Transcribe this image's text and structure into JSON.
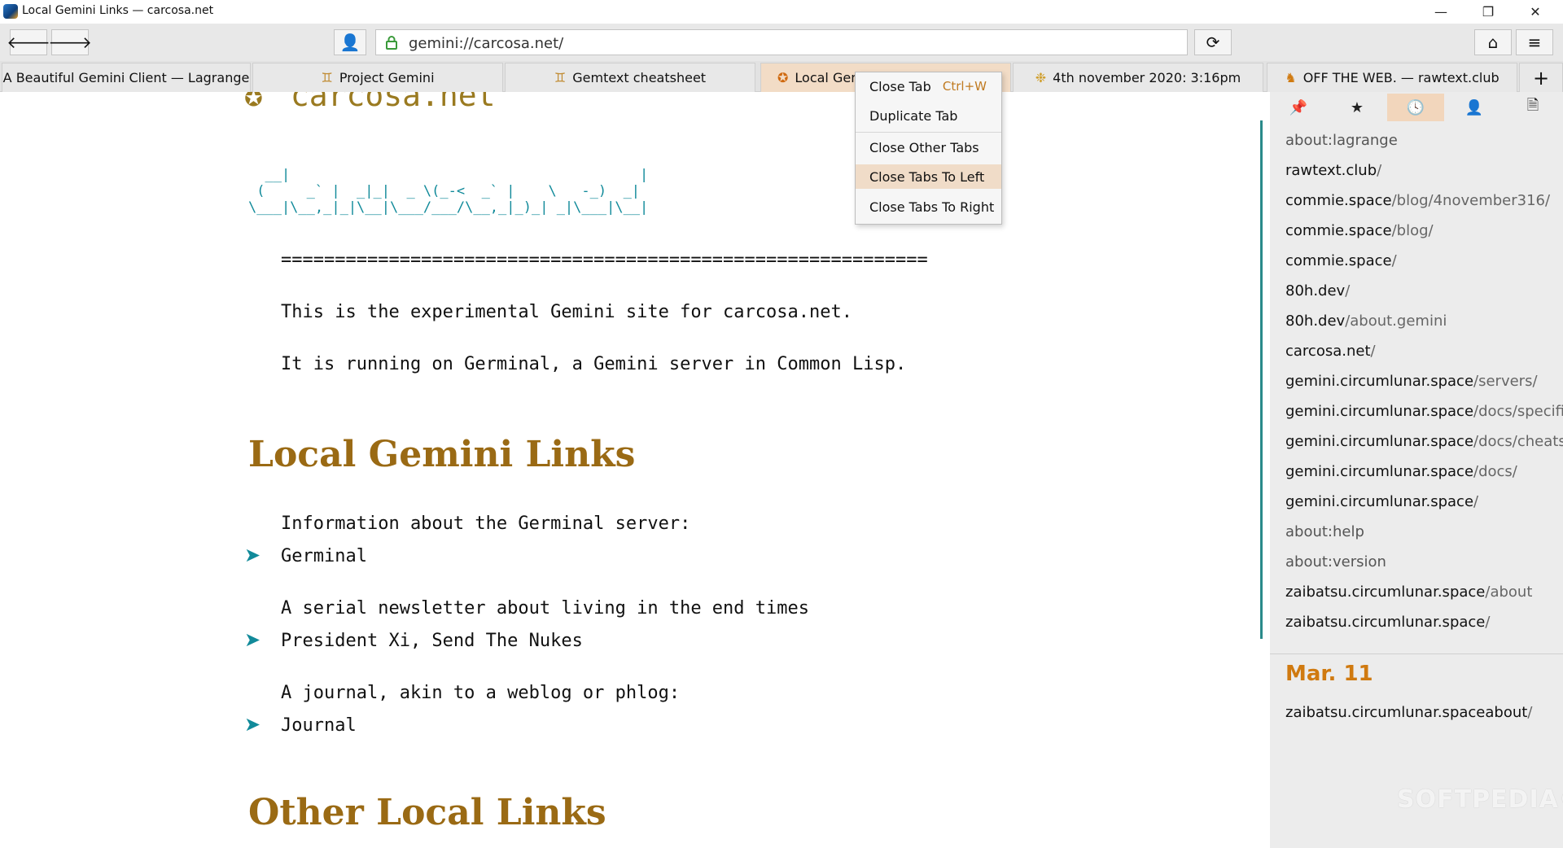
{
  "window": {
    "title": "Local Gemini Links — carcosa.net",
    "min_glyph": "—",
    "max_glyph": "❐",
    "close_glyph": "✕"
  },
  "nav": {
    "back_glyph": "🡐",
    "forward_glyph": "🡒",
    "identity_glyph": "👤",
    "url": "gemini://carcosa.net/",
    "reload_glyph": "⟳",
    "home_glyph": "⌂",
    "menu_glyph": "≡"
  },
  "tabs": [
    {
      "label": "A Beautiful Gemini Client — Lagrange",
      "icon": ""
    },
    {
      "label": "Project Gemini",
      "icon": "♊"
    },
    {
      "label": "Gemtext cheatsheet",
      "icon": "♊"
    },
    {
      "label": "Local Gemini Links",
      "icon": "✪"
    },
    {
      "label": "4th november 2020: 3:16pm",
      "icon": "❉"
    },
    {
      "label": "OFF THE WEB. — rawtext.club",
      "icon": "♞"
    }
  ],
  "new_tab_glyph": "+",
  "context_menu": {
    "items": [
      {
        "label": "Close Tab",
        "shortcut": "Ctrl+W"
      },
      {
        "label": "Duplicate Tab",
        "shortcut": ""
      },
      {
        "label": "Close Other Tabs",
        "shortcut": ""
      },
      {
        "label": "Close Tabs To Left",
        "shortcut": ""
      },
      {
        "label": "Close Tabs To Right",
        "shortcut": ""
      }
    ]
  },
  "page": {
    "banner_icon": "✪",
    "banner": "carcosa.net",
    "ascii_art": "  __|                                          |\n (     _` |  _|_|  _ \\(_-<  _` |    \\   -_)  _|\n\\___|\\__,_|_|\\__|\\___/___/\\__,_|_)_| _|\\___|\\__|",
    "rule": "============================================================",
    "intro_1": "This is the experimental Gemini site for carcosa.net.",
    "intro_2": "It is running on Germinal, a Gemini server in Common Lisp.",
    "heading_1": "Local Gemini Links",
    "desc_1": "Information about the Germinal server:",
    "link_1": "Germinal",
    "desc_2": "A serial newsletter about living in the end times",
    "link_2": "President Xi, Send The Nukes",
    "desc_3": "A journal, akin to a weblog or phlog:",
    "link_3": "Journal",
    "heading_2": "Other Local Links",
    "link_arrow": "➤"
  },
  "sidebar": {
    "tabs": [
      {
        "name": "pin",
        "glyph": "📌"
      },
      {
        "name": "bookmarks",
        "glyph": "★"
      },
      {
        "name": "history",
        "glyph": "🕓"
      },
      {
        "name": "identities",
        "glyph": "👤"
      },
      {
        "name": "outline",
        "glyph": "🗎"
      }
    ],
    "history": [
      {
        "host": "",
        "path": "about:lagrange"
      },
      {
        "host": "rawtext.club",
        "path": "/"
      },
      {
        "host": "commie.space",
        "path": "/blog/4november316/"
      },
      {
        "host": "commie.space",
        "path": "/blog/"
      },
      {
        "host": "commie.space",
        "path": "/"
      },
      {
        "host": "80h.dev",
        "path": "/"
      },
      {
        "host": "80h.dev",
        "path": "/about.gemini"
      },
      {
        "host": "carcosa.net",
        "path": "/"
      },
      {
        "host": "gemini.circumlunar.space",
        "path": "/servers/"
      },
      {
        "host": "gemini.circumlunar.space",
        "path": "/docs/specifica"
      },
      {
        "host": "gemini.circumlunar.space",
        "path": "/docs/cheatshe"
      },
      {
        "host": "gemini.circumlunar.space",
        "path": "/docs/"
      },
      {
        "host": "gemini.circumlunar.space",
        "path": "/"
      },
      {
        "host": "",
        "path": "about:help"
      },
      {
        "host": "",
        "path": "about:version"
      },
      {
        "host": "zaibatsu.circumlunar.space",
        "path": "/about"
      },
      {
        "host": "zaibatsu.circumlunar.space",
        "path": "/"
      }
    ],
    "date": "Mar. 11",
    "older": [
      {
        "host": "zaibatsu.circumlunar.spaceabout",
        "path": "/"
      }
    ]
  },
  "watermark": "SOFTPEDIA®"
}
